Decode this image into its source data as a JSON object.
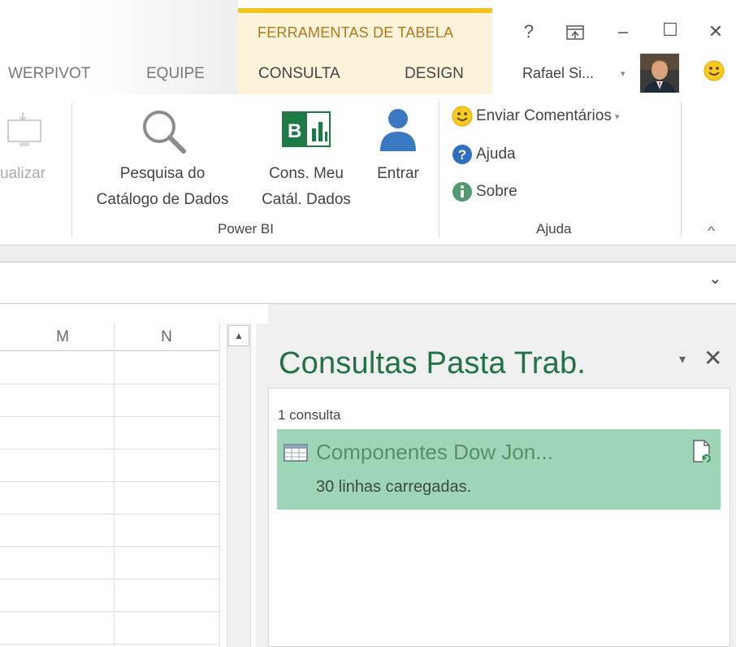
{
  "tabs": {
    "powerpivot": "WERPIVOT",
    "equipe": "EQUIPE",
    "consulta": "CONSULTA",
    "design": "DESIGN"
  },
  "tool_context": {
    "label": "FERRAMENTAS DE TABELA",
    "accent_color": "#f0c419",
    "background": "#fdf3db"
  },
  "window": {
    "help": "?",
    "restore_icon": "ribbon-display-icon",
    "minimize": "–",
    "maximize": "☐",
    "close": "✕"
  },
  "user": {
    "name": "Rafael Si...",
    "caret": "▾",
    "avatar_icon": "user-photo-icon",
    "feedback_icon": "smiley-icon"
  },
  "ribbon": {
    "atualizar": "ualizar",
    "pesquisa_line1": "Pesquisa do",
    "pesquisa_line2": "Catálogo de Dados",
    "cons_line1": "Cons. Meu",
    "cons_line2": "Catál. Dados",
    "entrar": "Entrar",
    "group_powerbi": "Power BI",
    "enviar": "Enviar Comentários",
    "enviar_caret": "▾",
    "ajuda_btn": "Ajuda",
    "sobre": "Sobre",
    "group_ajuda": "Ajuda",
    "collapse": "^"
  },
  "formula_bar": {
    "expand": "⌄"
  },
  "grid": {
    "columns": [
      "M",
      "N"
    ]
  },
  "pane": {
    "title": "Consultas Pasta Trab.",
    "menu": "▾",
    "close": "✕",
    "count": "1 consulta",
    "query": {
      "name": "Componentes Dow Jon...",
      "status": "30 linhas carregadas.",
      "highlight_color": "#9fd5b7"
    }
  },
  "colors": {
    "excel_green": "#217346",
    "tool_text": "#b5781a"
  }
}
